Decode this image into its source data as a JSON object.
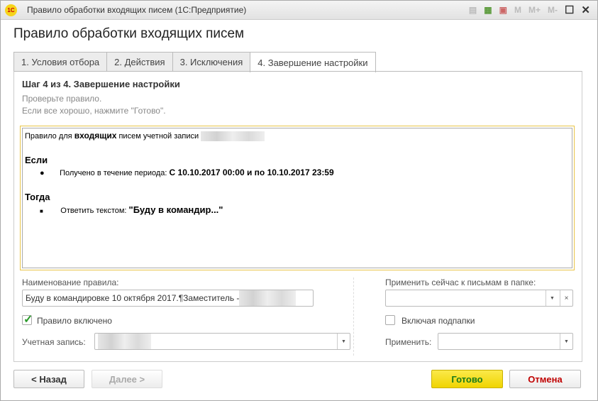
{
  "window": {
    "title": "Правило обработки входящих писем  (1С:Предприятие)",
    "logo": "1С",
    "icons": [
      "print-icon",
      "calculator-icon",
      "calendar-icon"
    ],
    "m_buttons": [
      "M",
      "M+",
      "M-"
    ]
  },
  "header": {
    "title": "Правило обработки входящих писем"
  },
  "tabs": [
    {
      "label": "1. Условия отбора"
    },
    {
      "label": "2. Действия"
    },
    {
      "label": "3. Исключения"
    },
    {
      "label": "4. Завершение настройки"
    }
  ],
  "step": {
    "title": "Шаг 4 из 4. Завершение настройки",
    "hint1": "Проверьте правило.",
    "hint2": "Если все хорошо, нажмите \"Готово\"."
  },
  "preview": {
    "intro_pre": "Правило для ",
    "intro_bold": "входящих",
    "intro_post": " писем учетной записи",
    "if_label": "Если",
    "if_item_label": "Получено в течение периода: ",
    "if_item_value": "С 10.10.2017 00:00 и по 10.10.2017 23:59",
    "then_label": "Тогда",
    "then_item_label": "Ответить текстом: ",
    "then_item_value": "\"Буду в командир...\""
  },
  "form": {
    "rule_name_label": "Наименование правила:",
    "rule_name_value": "Буду в командировке 10 октября 2017.¶Заместитель - ",
    "rule_enabled_label": "Правило включено",
    "rule_enabled": true,
    "account_label": "Учетная запись:",
    "apply_folder_label": "Применить сейчас к письмам в папке:",
    "apply_folder_value": "",
    "include_subfolders_label": "Включая подпапки",
    "include_subfolders": false,
    "apply_label": "Применить:",
    "apply_value": ""
  },
  "buttons": {
    "back": "< Назад",
    "next": "Далее >",
    "done": "Готово",
    "cancel": "Отмена"
  },
  "colors": {
    "done_bg": "#f5dc00",
    "done_text": "#1a7a1a",
    "cancel_text": "#c00000",
    "check": "#2a9a2a"
  }
}
